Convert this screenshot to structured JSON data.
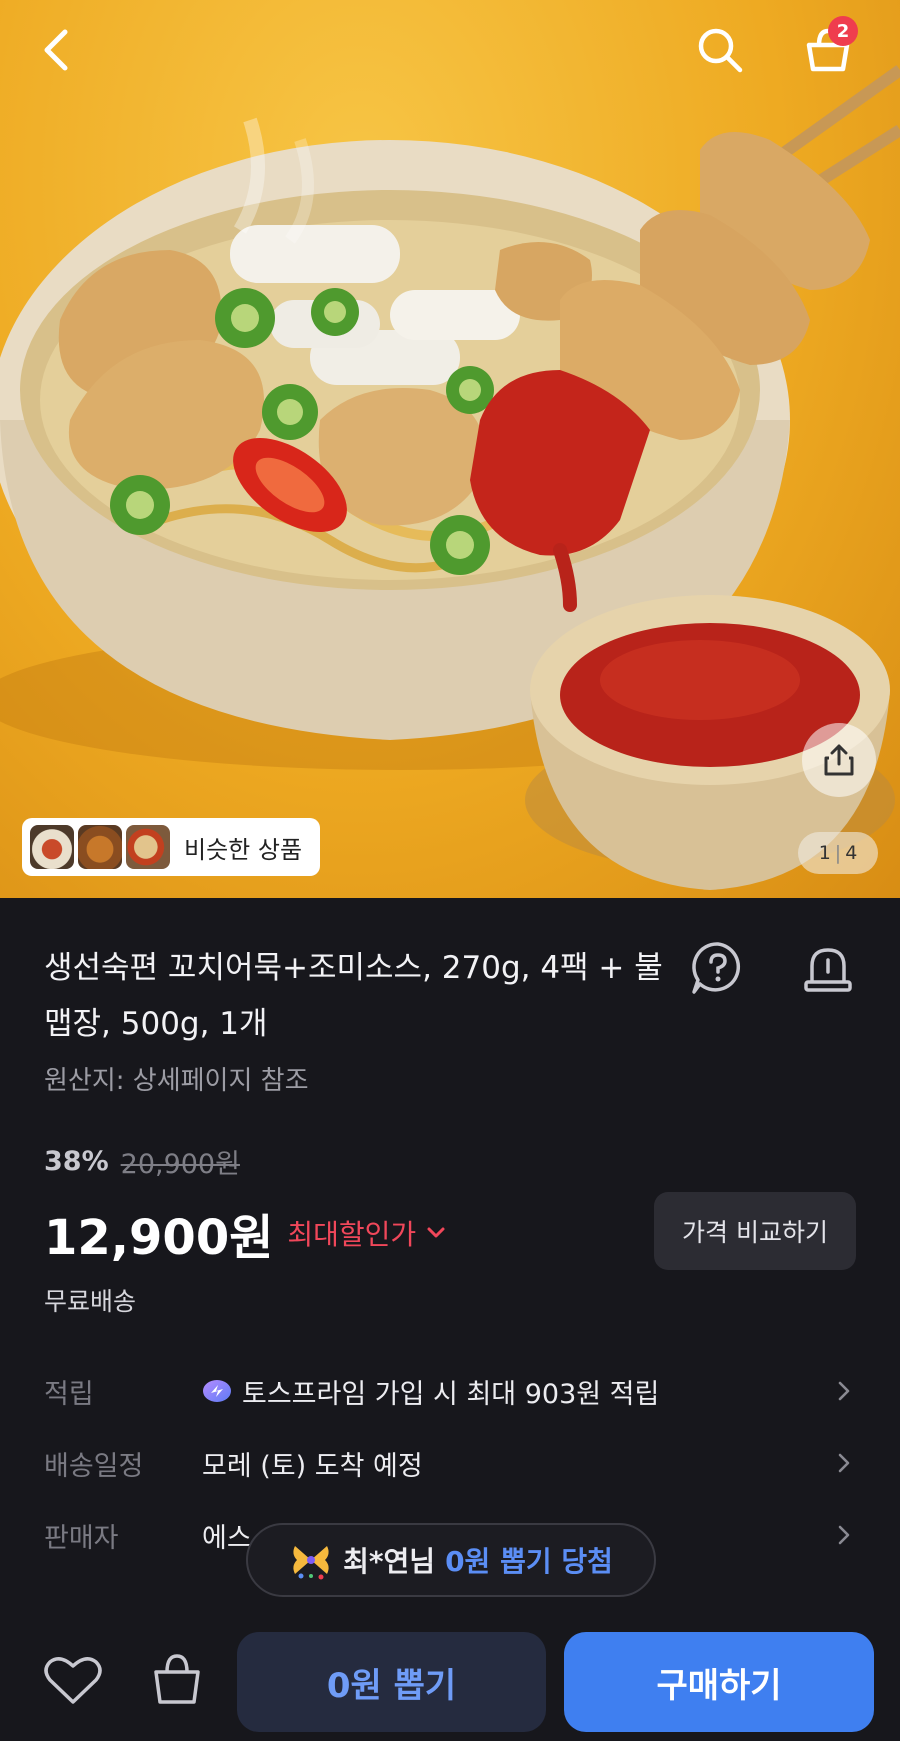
{
  "hero": {
    "cart_count": "2",
    "page_current": "1",
    "page_total": "4",
    "similar_label": "비슷한 상품"
  },
  "product": {
    "title": "생선숙편 꼬치어묵+조미소스, 270g, 4팩 + 불맵장, 500g, 1개",
    "origin": "원산지: 상세페이지 참조",
    "discount_rate": "38%",
    "original_price": "20,900원",
    "price": "12,900원",
    "max_discount_label": "최대할인가",
    "compare_label": "가격 비교하기",
    "shipping": "무료배송"
  },
  "details": [
    {
      "key": "적립",
      "value": "토스프라임 가입 시 최대 903원 적립"
    },
    {
      "key": "배송일정",
      "value": "모레 (토) 도착 예정"
    },
    {
      "key": "판매자",
      "value": "에스"
    }
  ],
  "toast": {
    "name": "최*연님",
    "text": "0원 뽑기 당첨"
  },
  "bottom": {
    "draw_label": "0원 뽑기",
    "buy_label": "구매하기"
  },
  "icons": {
    "back": "chevron-left-icon",
    "search": "search-icon",
    "cart": "basket-icon",
    "share": "share-icon",
    "help": "question-icon",
    "report": "siren-icon",
    "heart": "heart-icon",
    "bag": "shopping-bag-icon",
    "prime": "toss-prime-icon",
    "confetti": "confetti-icon",
    "chevron": "chevron-right-icon"
  },
  "colors": {
    "accent": "#3f7ff0",
    "discount_red": "#f0475a",
    "badge_red": "#ef3d4e",
    "background": "#17171c"
  }
}
